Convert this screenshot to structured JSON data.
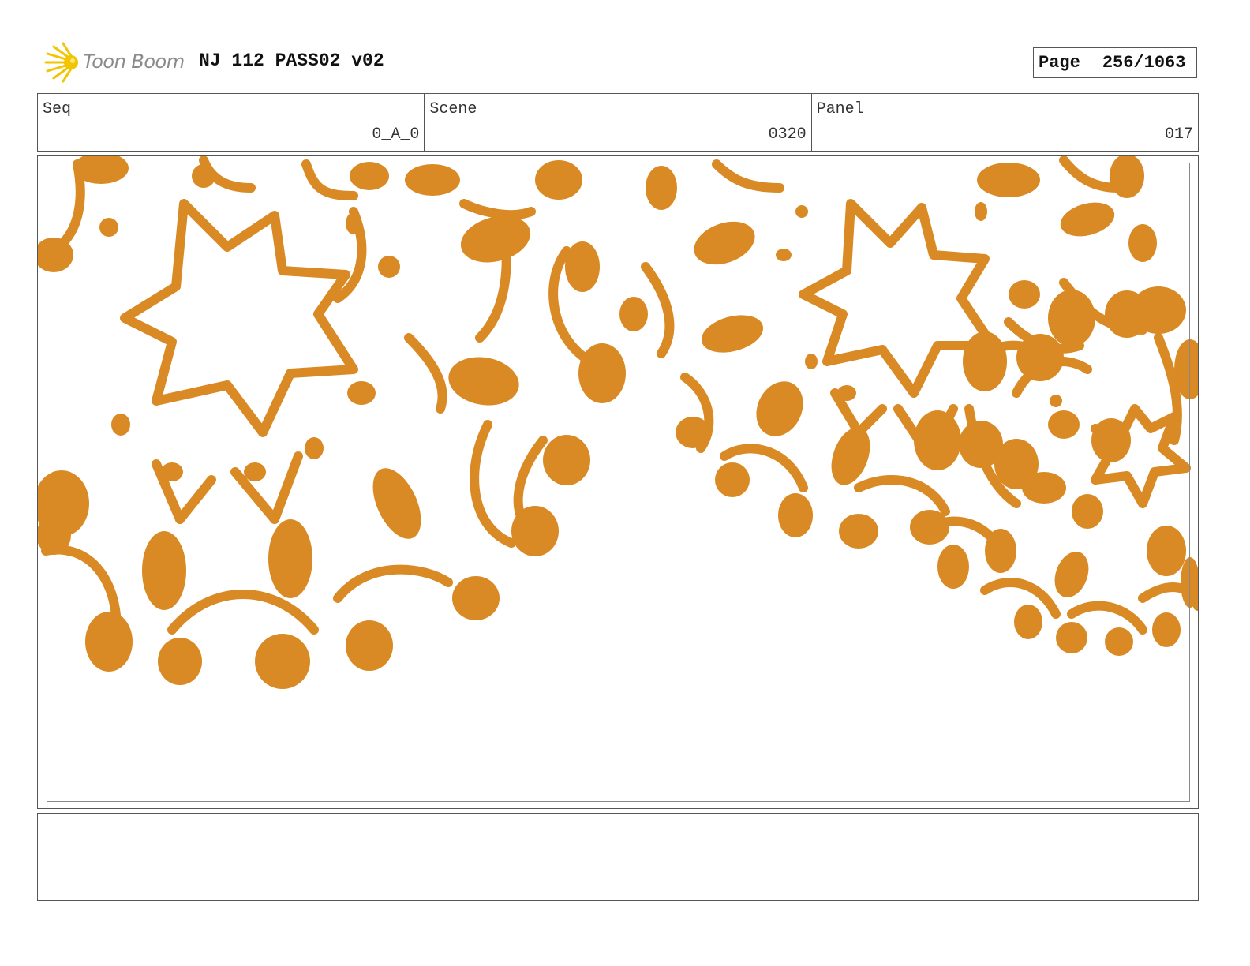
{
  "header": {
    "logo_text": "Toon Boom",
    "title": "NJ 112 PASS02 v02",
    "page_label": "Page",
    "page_number": "256/1063"
  },
  "info": {
    "seq_label": "Seq",
    "seq_value": "0_A_0",
    "scene_label": "Scene",
    "scene_value": "0320",
    "panel_label": "Panel",
    "panel_value": "017"
  },
  "panel": {
    "art_color": "#D98A24",
    "art_subject": "orange star and musical-note confetti pattern"
  },
  "notes": {
    "text": ""
  },
  "colors": {
    "logo_star": "#F2C500",
    "border": "#555555"
  }
}
